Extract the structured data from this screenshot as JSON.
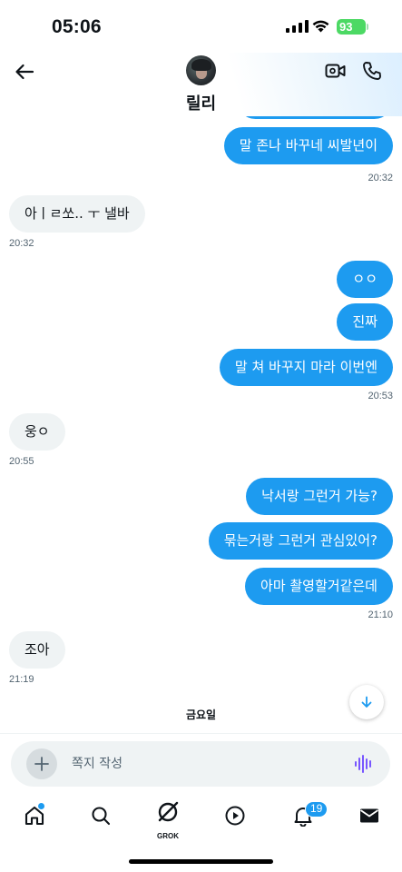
{
  "status_bar": {
    "time": "05:06",
    "battery": "93"
  },
  "header": {
    "contact_name": "릴리"
  },
  "messages": [
    {
      "dir": "out",
      "text": "말 존나 바꾸네 씨발년이"
    },
    {
      "dir": "in",
      "text": "아ㅣㄹ쏘.. ㅜ 낼바"
    },
    {
      "dir": "out",
      "text": "ㅇㅇ"
    },
    {
      "dir": "out",
      "text": "진짜"
    },
    {
      "dir": "out",
      "text": "말 쳐 바꾸지 마라 이번엔"
    },
    {
      "dir": "in",
      "text": "웅ㅇ"
    },
    {
      "dir": "out",
      "text": "낙서랑 그런거 가능?"
    },
    {
      "dir": "out",
      "text": "묶는거랑 그런거 관심있어?"
    },
    {
      "dir": "out",
      "text": "아마 촬영할거같은데"
    },
    {
      "dir": "in",
      "text": "조아"
    }
  ],
  "timestamps": [
    "20:32",
    "20:32",
    "20:53",
    "20:55",
    "21:10",
    "21:19"
  ],
  "date_separator": "금요일",
  "composer": {
    "placeholder": "쪽지 작성"
  },
  "nav": {
    "items": [
      "home-icon",
      "search-icon",
      "grok-icon",
      "video-icon",
      "bell-icon",
      "mail-icon"
    ],
    "grok_label": "GROK",
    "notification_count": "19"
  },
  "colors": {
    "accent": "#1d9bf0",
    "incoming_bubble": "#eff3f4",
    "battery": "#4cd964"
  }
}
